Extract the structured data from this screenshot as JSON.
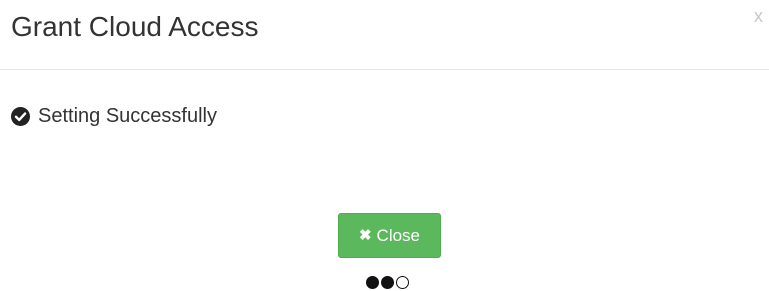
{
  "dialog": {
    "title": "Grant Cloud Access",
    "close_x_label": "x",
    "message": "Setting Successfully",
    "close_button_label": "Close"
  },
  "colors": {
    "button_bg": "#5cb85c",
    "button_border": "#4cae4c",
    "title_text": "#333333"
  },
  "icons": {
    "status": "check-circle-icon",
    "button": "times-icon"
  },
  "progress": {
    "steps_total": 3,
    "steps_completed": 2
  }
}
